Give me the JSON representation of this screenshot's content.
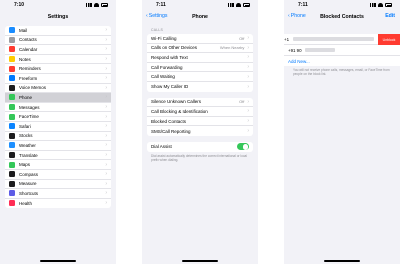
{
  "screen1": {
    "time": "7:10",
    "title": "Settings",
    "items": [
      {
        "label": "Mail",
        "icon": "mail-icon",
        "color": "#1a8cff"
      },
      {
        "label": "Contacts",
        "icon": "contacts-icon",
        "color": "#9c9ca1"
      },
      {
        "label": "Calendar",
        "icon": "calendar-icon",
        "color": "#ff3b30"
      },
      {
        "label": "Notes",
        "icon": "notes-icon",
        "color": "#ffcc00"
      },
      {
        "label": "Reminders",
        "icon": "reminders-icon",
        "color": "#ff3b30"
      },
      {
        "label": "Freeform",
        "icon": "freeform-icon",
        "color": "#007aff"
      },
      {
        "label": "Voice Memos",
        "icon": "voice-memos-icon",
        "color": "#1c1c1e"
      },
      {
        "label": "Phone",
        "icon": "phone-icon",
        "color": "#34c759"
      },
      {
        "label": "Messages",
        "icon": "messages-icon",
        "color": "#34c759"
      },
      {
        "label": "FaceTime",
        "icon": "facetime-icon",
        "color": "#34c759"
      },
      {
        "label": "Safari",
        "icon": "safari-icon",
        "color": "#0a84ff"
      },
      {
        "label": "Stocks",
        "icon": "stocks-icon",
        "color": "#1c1c1e"
      },
      {
        "label": "Weather",
        "icon": "weather-icon",
        "color": "#1e90ff"
      },
      {
        "label": "Translate",
        "icon": "translate-icon",
        "color": "#1c1c1e"
      },
      {
        "label": "Maps",
        "icon": "maps-icon",
        "color": "#34c759"
      },
      {
        "label": "Compass",
        "icon": "compass-icon",
        "color": "#1c1c1e"
      },
      {
        "label": "Measure",
        "icon": "measure-icon",
        "color": "#1c1c1e"
      },
      {
        "label": "Shortcuts",
        "icon": "shortcuts-icon",
        "color": "#5e5ce6"
      },
      {
        "label": "Health",
        "icon": "health-icon",
        "color": "#ff2d55"
      }
    ]
  },
  "screen2": {
    "time": "7:11",
    "back_label": "Settings",
    "title": "Phone",
    "section_header": "CALLS",
    "group1": [
      {
        "label": "Wi-Fi Calling",
        "value": "Off"
      },
      {
        "label": "Calls on Other Devices",
        "value": "When Nearby"
      },
      {
        "label": "Respond with Text",
        "value": ""
      },
      {
        "label": "Call Forwarding",
        "value": ""
      },
      {
        "label": "Call Waiting",
        "value": ""
      },
      {
        "label": "Show My Caller ID",
        "value": ""
      }
    ],
    "group2": [
      {
        "label": "Silence Unknown Callers",
        "value": "Off"
      },
      {
        "label": "Call Blocking & Identification",
        "value": ""
      },
      {
        "label": "Blocked Contacts",
        "value": ""
      },
      {
        "label": "SMS/Call Reporting",
        "value": ""
      }
    ],
    "dial_assist_label": "Dial Assist",
    "dial_assist_note": "Dial assist automatically determines the correct international or local prefix when dialing."
  },
  "screen3": {
    "time": "7:11",
    "back_label": "Phone",
    "title": "Blocked Contacts",
    "edit_label": "Edit",
    "contact1": "+1",
    "unblock_label": "Unblock",
    "contact2": "+91 90",
    "add_new": "Add New...",
    "note": "You will not receive phone calls, messages, email, or FaceTime from people on the block list."
  },
  "colors": {
    "accent": "#007aff",
    "toggle_on": "#34c759",
    "destructive": "#ff3b30",
    "background": "#f2f2f7"
  }
}
